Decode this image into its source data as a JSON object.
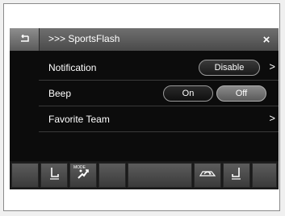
{
  "header": {
    "title": ">>> SportsFlash",
    "back_icon": "back-arrow-icon",
    "close_label": "×"
  },
  "rows": [
    {
      "label": "Notification",
      "button_label": "Disable",
      "chevron": ">"
    },
    {
      "label": "Beep",
      "on_label": "On",
      "off_label": "Off",
      "selected": "Off"
    },
    {
      "label": "Favorite Team",
      "chevron": ">"
    }
  ],
  "bottom_bar": {
    "mode_label": "MODE",
    "icons": [
      "blank",
      "driver-seat-heat-icon",
      "mode-fan-icon",
      "blank",
      "blank-wide",
      "recirculation-car-icon",
      "passenger-seat-heat-icon",
      "blank"
    ]
  },
  "colors": {
    "screen_bg": "#0c0c0c",
    "titlebar": "#5a5a5a",
    "selected_pill": "#7a7a7a"
  }
}
